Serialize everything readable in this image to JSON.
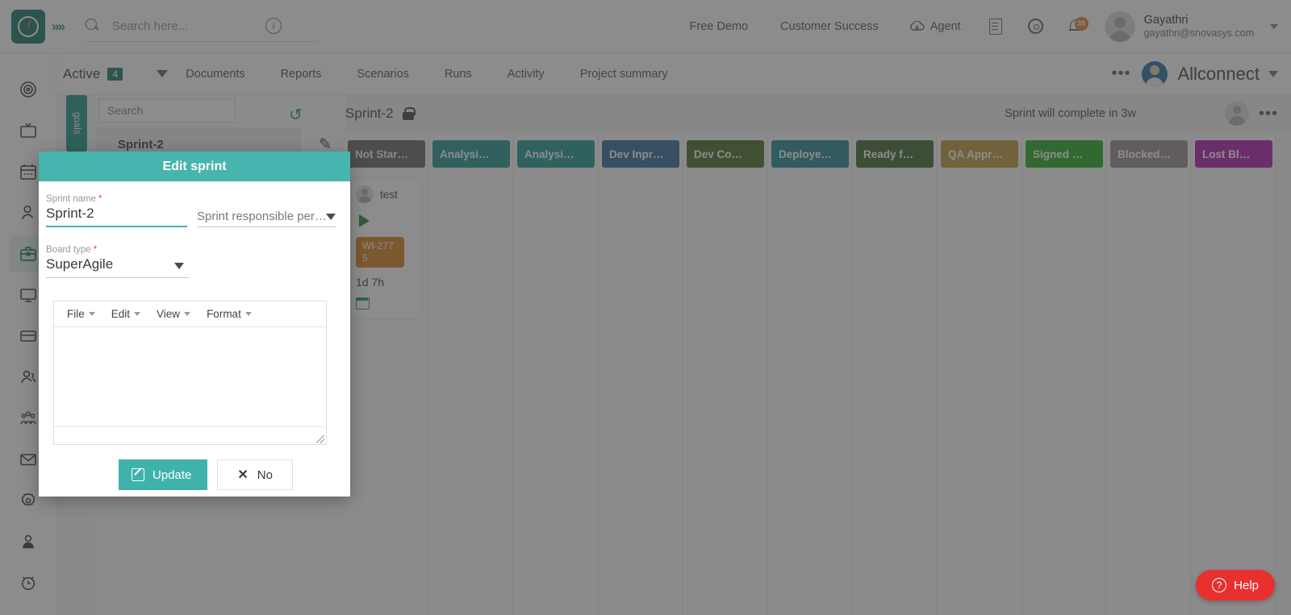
{
  "topbar": {
    "logo_name": "app-logo",
    "expand_label": "»»",
    "search_placeholder": "Search here...",
    "search_value": "",
    "links": [
      {
        "label": "Free Demo",
        "name": "free-demo-link"
      },
      {
        "label": "Customer Success",
        "name": "customer-success-link"
      }
    ],
    "agent_label": "Agent",
    "notification_count": "35",
    "user": {
      "name": "Gayathri",
      "email": "gayathri@snovasys.com"
    }
  },
  "subbar": {
    "active_label": "Active",
    "active_count": "4",
    "links": [
      {
        "label": "Documents",
        "name": "tab-documents"
      },
      {
        "label": "Reports",
        "name": "tab-reports"
      },
      {
        "label": "Scenarios",
        "name": "tab-scenarios"
      },
      {
        "label": "Runs",
        "name": "tab-runs"
      },
      {
        "label": "Activity",
        "name": "tab-activity"
      },
      {
        "label": "Project summary",
        "name": "tab-project-summary"
      }
    ],
    "overflow_dots": "•••",
    "project_name": "Allconnect"
  },
  "rail": {
    "items": [
      {
        "name": "sidebar-item-dashboard",
        "icon": "spiral-icon",
        "active": false
      },
      {
        "name": "sidebar-item-tv",
        "icon": "tv-icon",
        "active": false
      },
      {
        "name": "sidebar-item-calendar",
        "icon": "calendar-icon",
        "active": false
      },
      {
        "name": "sidebar-item-profile",
        "icon": "person-icon",
        "active": false
      },
      {
        "name": "sidebar-item-projects",
        "icon": "briefcase-icon",
        "active": true
      },
      {
        "name": "sidebar-item-monitor",
        "icon": "monitor-icon",
        "active": false
      },
      {
        "name": "sidebar-item-billing",
        "icon": "card-icon",
        "active": false
      },
      {
        "name": "sidebar-item-teams",
        "icon": "people-icon",
        "active": false
      },
      {
        "name": "sidebar-item-groups",
        "icon": "group-icon",
        "active": false
      },
      {
        "name": "sidebar-item-mail",
        "icon": "envelope-icon",
        "active": false
      },
      {
        "name": "sidebar-item-settings",
        "icon": "gear-icon",
        "active": false
      },
      {
        "name": "sidebar-item-account",
        "icon": "user-badge-icon",
        "active": false
      },
      {
        "name": "sidebar-item-timer",
        "icon": "alarm-clock-icon",
        "active": false
      }
    ]
  },
  "panel": {
    "goals_tab_label": "goals",
    "search_placeholder": "Search",
    "search_value": "",
    "sprint_row_name": "Sprint-2",
    "edit_tooltip": "Edit sprint"
  },
  "board": {
    "sprint_title": "Sprint-2",
    "sprint_note": "Sprint will complete in 3w",
    "dots": "•••",
    "columns": [
      {
        "label": "Not Star…",
        "color": "#5b5b5b",
        "name": "column-not-started"
      },
      {
        "label": "Analysi…",
        "color": "#0e8e8a",
        "name": "column-analysis-1"
      },
      {
        "label": "Analysi…",
        "color": "#0e8e8a",
        "name": "column-analysis-2"
      },
      {
        "label": "Dev Inpr…",
        "color": "#1e5f93",
        "name": "column-dev-inprogress"
      },
      {
        "label": "Dev Co…",
        "color": "#3c6215",
        "name": "column-dev-completed"
      },
      {
        "label": "Deploye…",
        "color": "#117f86",
        "name": "column-deployed"
      },
      {
        "label": "Ready f…",
        "color": "#2f5c22",
        "name": "column-ready-for"
      },
      {
        "label": "QA Appr…",
        "color": "#b8902b",
        "name": "column-qa-approved"
      },
      {
        "label": "Signed …",
        "color": "#11a411",
        "name": "column-signed-off"
      },
      {
        "label": "Blocked…",
        "color": "#8e8482",
        "name": "column-blocked"
      },
      {
        "label": "Lost Bl…",
        "color": "#a50ba5",
        "name": "column-lost-blocked"
      }
    ],
    "card": {
      "user": "test",
      "work_item_id": "WI-2775",
      "estimate": "1d 7h"
    }
  },
  "modal": {
    "title": "Edit sprint",
    "sprint_name_label": "Sprint name",
    "sprint_name_value": "Sprint-2",
    "responsible_placeholder": "Sprint responsible per…",
    "board_type_label": "Board type",
    "board_type_value": "SuperAgile",
    "required_mark": "*",
    "editor_menu": [
      {
        "label": "File",
        "name": "editor-menu-file"
      },
      {
        "label": "Edit",
        "name": "editor-menu-edit"
      },
      {
        "label": "View",
        "name": "editor-menu-view"
      },
      {
        "label": "Format",
        "name": "editor-menu-format"
      }
    ],
    "editor_content": "",
    "update_label": "Update",
    "no_label": "No",
    "no_icon": "✕"
  },
  "help": {
    "label": "Help",
    "icon_glyph": "?"
  },
  "colors": {
    "accent_teal": "#46b5ad",
    "brand_green": "#046a5c",
    "badge_orange": "#d4760f",
    "help_red": "#e8302f"
  }
}
